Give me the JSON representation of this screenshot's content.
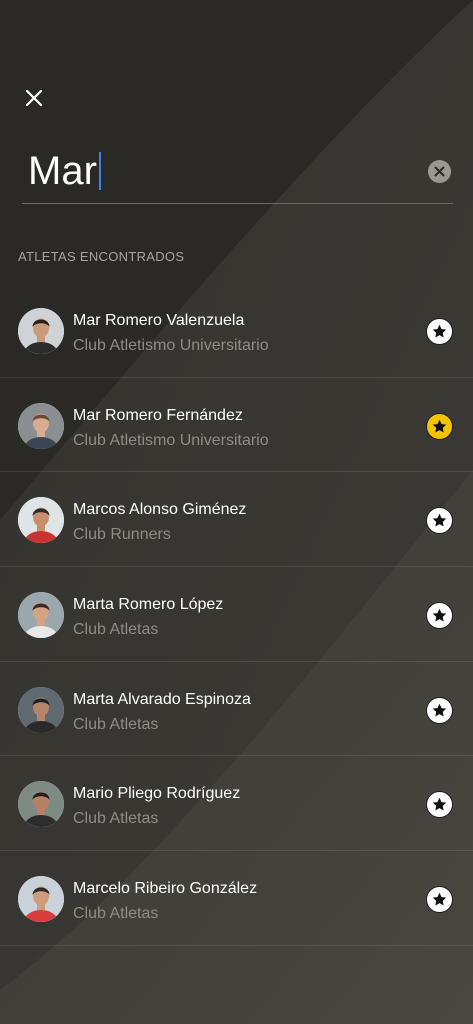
{
  "search": {
    "value": "Mar",
    "close_icon": "close-icon",
    "clear_icon": "clear-circle-icon"
  },
  "section": {
    "label": "ATLETAS ENCONTRADOS"
  },
  "colors": {
    "favorite_on": "#f5c400",
    "favorite_off": "#ffffff",
    "caret": "#3b82f6"
  },
  "athletes": [
    {
      "name": "Mar Romero Valenzuela",
      "club": "Club Atletismo Universitario",
      "favorite": false
    },
    {
      "name": "Mar Romero Fernández",
      "club": "Club Atletismo Universitario",
      "favorite": true
    },
    {
      "name": "Marcos Alonso Giménez",
      "club": "Club Runners",
      "favorite": false
    },
    {
      "name": "Marta Romero López",
      "club": "Club Atletas",
      "favorite": false
    },
    {
      "name": "Marta Alvarado Espinoza",
      "club": "Club Atletas",
      "favorite": false
    },
    {
      "name": "Mario Pliego Rodríguez",
      "club": "Club Atletas",
      "favorite": false
    },
    {
      "name": "Marcelo Ribeiro González",
      "club": "Club Atletas",
      "favorite": false
    }
  ]
}
